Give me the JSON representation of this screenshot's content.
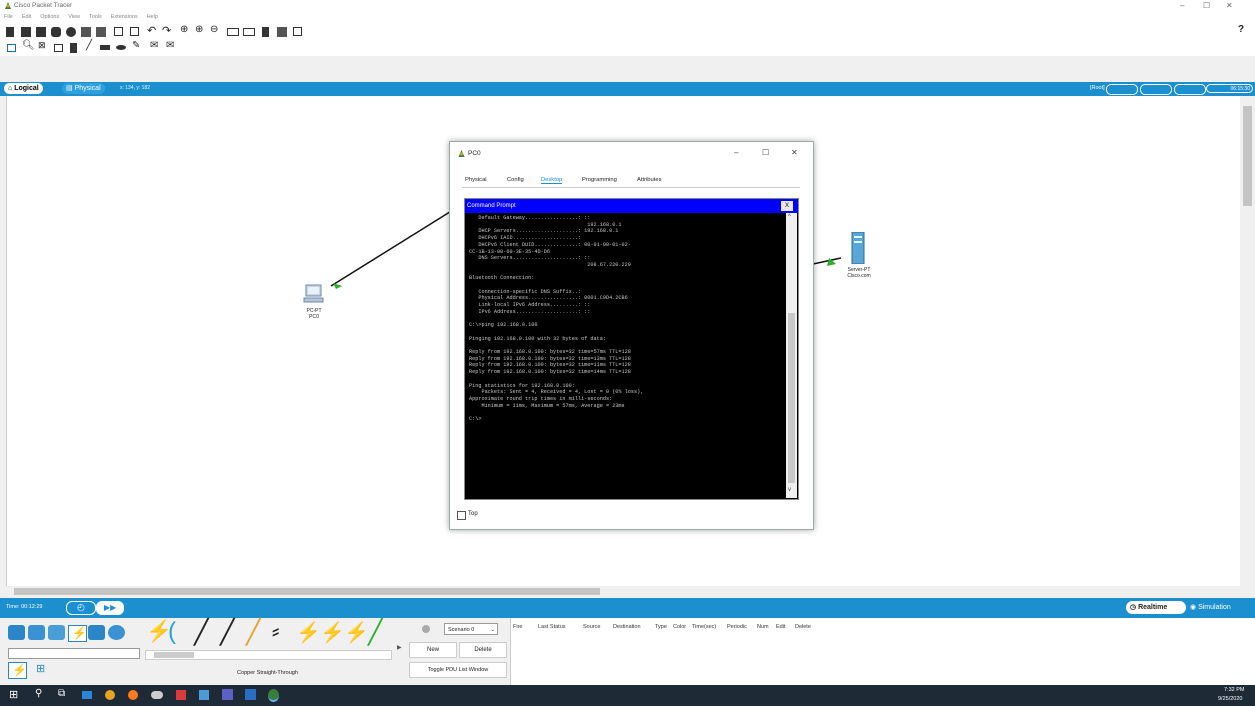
{
  "app": {
    "title": "Cisco Packet Tracer",
    "help_glyph": "?"
  },
  "window_controls": {
    "minimize": "–",
    "maximize": "☐",
    "close": "✕"
  },
  "menu": [
    "File",
    "Edit",
    "Options",
    "View",
    "Tools",
    "Extensions",
    "Help"
  ],
  "workspace_tabs": {
    "logical": "Logical",
    "physical": "Physical",
    "coords": "x: 134, y: 182"
  },
  "topright": {
    "root": "[Root]",
    "clock": "06:15:30"
  },
  "devices": {
    "pc": {
      "type": "PC-PT",
      "name": "PC0"
    },
    "server": {
      "type": "Server-PT",
      "name": "Cisco.com"
    }
  },
  "dialog": {
    "title": "PC0",
    "tabs": [
      "Physical",
      "Config",
      "Desktop",
      "Programming",
      "Attributes"
    ],
    "active_tab": "Desktop",
    "cmd_title": "Command Prompt",
    "cmd_close": "X",
    "top_checkbox_label": "Top",
    "cmd_lines": [
      "   Default Gateway.................: ::",
      "                                      192.168.0.1",
      "   DHCP Servers....................: 192.168.0.1",
      "   DHCPv6 IAID.....................:",
      "   DHCPv6 Client DUID..............: 00-01-00-01-02-",
      "CC-1B-13-00-60-3E-35-4D-D6",
      "   DNS Servers.....................: ::",
      "                                      208.67.220.220",
      "",
      "Bluetooth Connection:",
      "",
      "   Connection-specific DNS Suffix..:",
      "   Physical Address................: 0001.C9D4.2CB6",
      "   Link-local IPv6 Address.........: ::",
      "   IPv6 Address....................: ::",
      "",
      "C:\\>ping 192.168.0.100",
      "",
      "Pinging 192.168.0.100 with 32 bytes of data:",
      "",
      "Reply from 192.168.0.100: bytes=32 time=57ms TTL=128",
      "Reply from 192.168.0.100: bytes=32 time=13ms TTL=128",
      "Reply from 192.168.0.100: bytes=32 time=11ms TTL=128",
      "Reply from 192.168.0.100: bytes=32 time=14ms TTL=128",
      "",
      "Ping statistics for 192.168.0.100:",
      "    Packets: Sent = 4, Received = 4, Lost = 0 (0% loss),",
      "Approximate round trip times in milli-seconds:",
      "    Minimum = 11ms, Maximum = 57ms, Average = 23ms",
      "",
      "C:\\>"
    ]
  },
  "timebar": {
    "time": "Time: 00:12:29",
    "realtime": "Realtime",
    "simulation": "Simulation"
  },
  "bottom": {
    "connection_label": "Copper Straight-Through",
    "scenario": "Scenario 0",
    "new_button": "New",
    "delete_button": "Delete",
    "toggle_pdu": "Toggle PDU List Window",
    "pdu_columns": [
      "Fire",
      "Last Status",
      "Source",
      "Destination",
      "Type",
      "Color",
      "Time(sec)",
      "Periodic",
      "Num",
      "Edit",
      "Delete"
    ]
  },
  "taskbar": {
    "time": "7:32 PM",
    "date": "9/25/2020"
  },
  "colors": {
    "accent": "#1c8fcf",
    "cmd_title": "#0000ff",
    "link_green": "#22aa22"
  }
}
